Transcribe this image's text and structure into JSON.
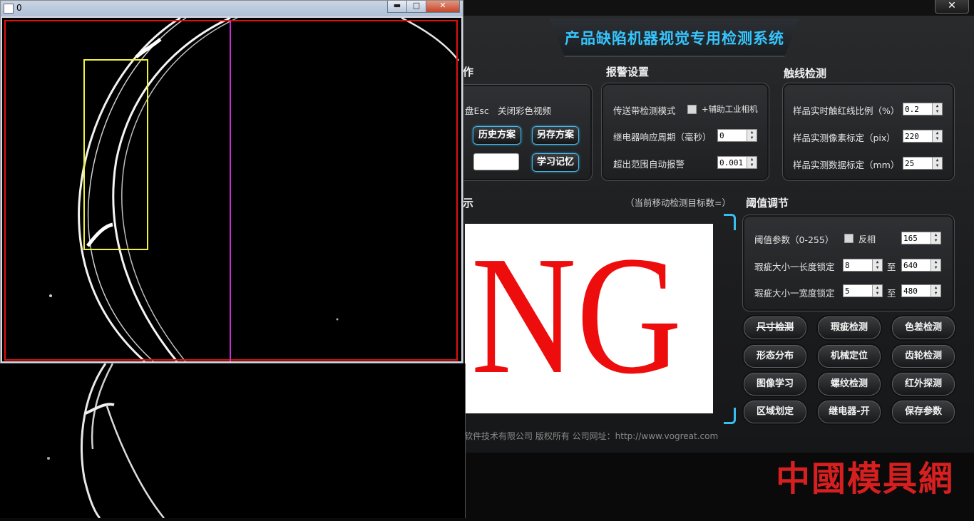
{
  "app": {
    "title": "产品缺陷机器视觉专用检测系统",
    "close_glyph": "✕",
    "operations": {
      "header": "作",
      "esc_text": "盘Esc",
      "close_color_video": "关闭彩色视频",
      "history_button": "历史方案",
      "save_as_button": "另存方案",
      "learn_memory_button": "学习记忆"
    },
    "alarm": {
      "header": "报警设置",
      "conveyor_mode": "传送带检测模式",
      "aux_camera": "+辅助工业相机",
      "relay_period_label": "继电器响应周期（毫秒）",
      "relay_period_value": "0",
      "out_of_range_label": "超出范围自动报警",
      "out_of_range_value": "0.001"
    },
    "tripwire": {
      "header": "触线检测",
      "ratio_label": "样品实时触红线比例（%）",
      "ratio_value": "0.2",
      "pixel_label": "样品实测像素标定（pix）",
      "pixel_value": "220",
      "mm_label": "样品实测数据标定（mm）",
      "mm_value": "25"
    },
    "display": {
      "header": "示",
      "target_count": "（当前移动检测目标数=）",
      "result": "NG"
    },
    "threshold": {
      "header": "阈值调节",
      "param_label": "阈值参数（0-255）",
      "invert_label": "反相",
      "param_value": "165",
      "length_label": "瑕疵大小一长度锁定",
      "length_min": "8",
      "length_max": "640",
      "width_label": "瑕疵大小一宽度锁定",
      "width_min": "5",
      "width_max": "480",
      "to": "至"
    },
    "function_buttons": [
      "尺寸检测",
      "瑕疵检测",
      "色差检测",
      "形态分布",
      "机械定位",
      "齿轮检测",
      "图像学习",
      "螺纹检测",
      "红外探测",
      "区域划定",
      "继电器-开",
      "保存参数"
    ],
    "footer": "软件技术有限公司  版权所有  公司网址：http://www.vogreat.com"
  },
  "viewer": {
    "title": "0",
    "min_glyph": "▬",
    "max_glyph": "□",
    "close_glyph": "✕"
  },
  "watermark": "中國模具網",
  "colors": {
    "accent": "#35c6ff",
    "ng_red": "#ee0d0d",
    "roi_yellow": "#f2f23a",
    "roi_red": "#e01010",
    "divider_magenta": "#d12ad8"
  }
}
